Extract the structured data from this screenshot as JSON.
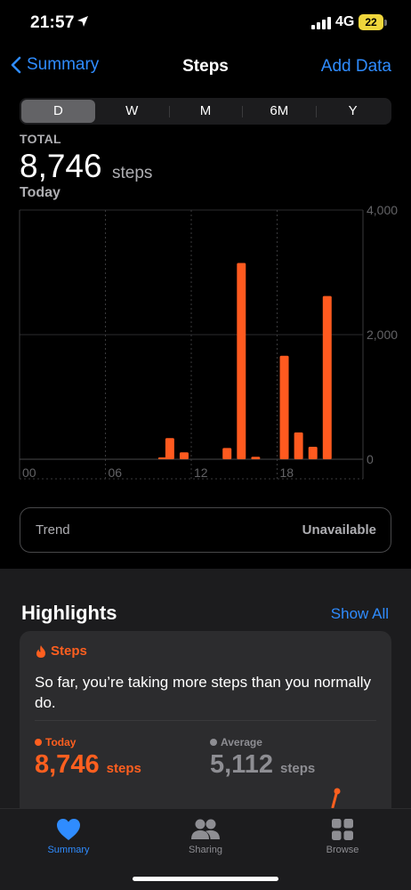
{
  "status": {
    "time": "21:57",
    "network": "4G",
    "battery": "22"
  },
  "nav": {
    "back_label": "Summary",
    "title": "Steps",
    "action_label": "Add Data"
  },
  "segments": [
    {
      "label": "D",
      "active": true
    },
    {
      "label": "W",
      "active": false
    },
    {
      "label": "M",
      "active": false
    },
    {
      "label": "6M",
      "active": false
    },
    {
      "label": "Y",
      "active": false
    }
  ],
  "summary": {
    "total_label": "TOTAL",
    "value": "8,746",
    "unit": "steps",
    "date": "Today"
  },
  "chart_data": {
    "type": "bar",
    "x_ticks": [
      "00",
      "06",
      "12",
      "18"
    ],
    "y_ticks": [
      "4,000",
      "2,000",
      "0"
    ],
    "ylim": [
      0,
      4000
    ],
    "xlim": [
      0,
      24
    ],
    "grid": true,
    "color": "#ff5a1f",
    "bars": [
      {
        "hour": 9.5,
        "value": 30
      },
      {
        "hour": 10,
        "value": 340
      },
      {
        "hour": 11,
        "value": 110
      },
      {
        "hour": 14,
        "value": 180
      },
      {
        "hour": 15,
        "value": 3150
      },
      {
        "hour": 16,
        "value": 40
      },
      {
        "hour": 18,
        "value": 1660
      },
      {
        "hour": 19,
        "value": 430
      },
      {
        "hour": 20,
        "value": 200
      },
      {
        "hour": 21,
        "value": 2620
      }
    ]
  },
  "trend": {
    "label": "Trend",
    "value": "Unavailable"
  },
  "highlights": {
    "title": "Highlights",
    "show_all": "Show All",
    "card": {
      "category": "Steps",
      "text": "So far, you’re taking more steps than you normally do.",
      "today_label": "Today",
      "today_value": "8,746",
      "today_unit": "steps",
      "avg_label": "Average",
      "avg_value": "5,112",
      "avg_unit": "steps"
    }
  },
  "tabs": [
    {
      "label": "Summary",
      "active": true
    },
    {
      "label": "Sharing",
      "active": false
    },
    {
      "label": "Browse",
      "active": false
    }
  ],
  "colors": {
    "accent": "#2f8cff",
    "steps": "#ff5f1f",
    "inactive": "#8e8e93"
  }
}
